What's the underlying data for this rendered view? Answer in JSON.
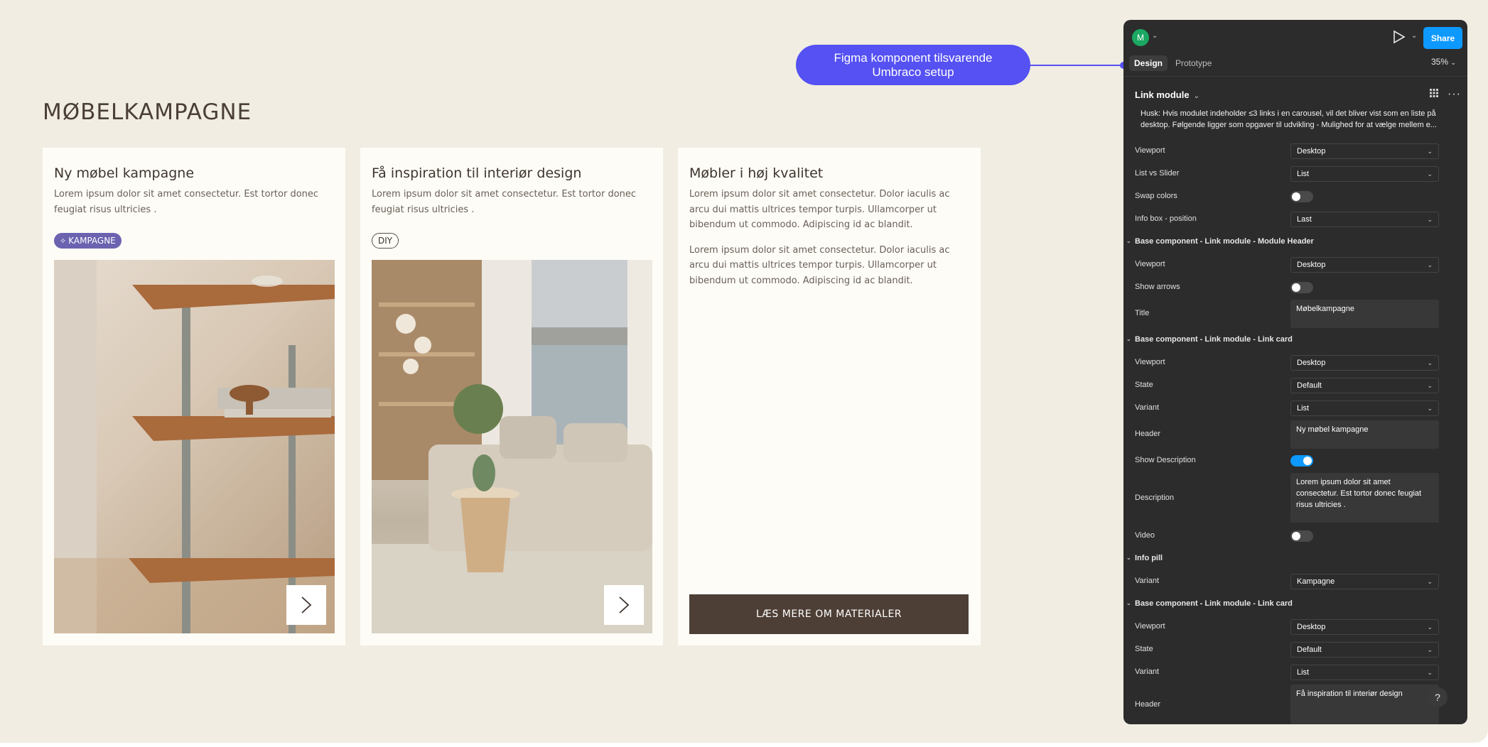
{
  "canvas": {
    "module_title": "MØBELKAMPAGNE",
    "cards": [
      {
        "header": "Ny møbel kampagne",
        "description": "Lorem ipsum dolor sit amet consectetur. Est tortor donec feugiat risus ultricies .",
        "pill": "KAMPAGNE",
        "image_alt": "Wooden shelf with books and mushroom lamp"
      },
      {
        "header": "Få inspiration til interiør design",
        "description": "Lorem ipsum dolor sit amet consectetur. Est tortor donec feugiat risus ultricies .",
        "pill": "DIY",
        "image_alt": "Living room with sofa, side table and lake view"
      },
      {
        "header": "Møbler i høj kvalitet",
        "paragraph_1": "Lorem ipsum dolor sit amet consectetur. Dolor iaculis ac arcu dui mattis ultrices tempor turpis. Ullamcorper ut bibendum ut commodo. Adipiscing id ac blandit.",
        "paragraph_2": "Lorem ipsum dolor sit amet consectetur. Dolor iaculis ac arcu dui mattis ultrices tempor turpis. Ullamcorper ut bibendum ut commodo. Adipiscing id ac blandit.",
        "cta": "LÆS MERE OM MATERIALER"
      }
    ]
  },
  "callout": {
    "line1": "Figma komponent tilsvarende",
    "line2": "Umbraco setup"
  },
  "panel": {
    "avatar_letter": "M",
    "share_label": "Share",
    "tabs": [
      "Design",
      "Prototype"
    ],
    "zoom": "35%",
    "component_name": "Link module",
    "note": "Husk: Hvis modulet indeholder ≤3 links i en carousel, vil det bliver vist som en liste på desktop. Følgende ligger som opgaver til udvikling - Mulighed for at vælge mellem e...",
    "props": [
      {
        "label": "Viewport",
        "value": "Desktop"
      },
      {
        "label": "List vs Slider",
        "value": "List"
      },
      {
        "label": "Swap colors"
      },
      {
        "label": "Info box - position",
        "value": "Last"
      }
    ],
    "section_header": "Base component - Link module - Module Header",
    "header_props": [
      {
        "label": "Viewport",
        "value": "Desktop"
      },
      {
        "label": "Show arrows"
      },
      {
        "label": "Title",
        "value": "Møbelkampagne"
      }
    ],
    "section_card1": "Base component - Link module - Link card",
    "card1_props": [
      {
        "label": "Viewport",
        "value": "Desktop"
      },
      {
        "label": "State",
        "value": "Default"
      },
      {
        "label": "Variant",
        "value": "List"
      },
      {
        "label": "Header",
        "value": "Ny møbel kampagne"
      },
      {
        "label": "Show Description"
      },
      {
        "label": "Description",
        "value": "Lorem ipsum dolor sit amet consectetur. Est tortor donec feugiat risus ultricies ."
      },
      {
        "label": "Video"
      }
    ],
    "section_pill": "Info pill",
    "pill_props": [
      {
        "label": "Variant",
        "value": "Kampagne"
      }
    ],
    "section_card2": "Base component - Link module - Link card",
    "card2_props": [
      {
        "label": "Viewport",
        "value": "Desktop"
      },
      {
        "label": "State",
        "value": "Default"
      },
      {
        "label": "Variant",
        "value": "List"
      },
      {
        "label": "Header",
        "value": "Få inspiration til interiør design"
      }
    ],
    "help_label": "?",
    "colors": {
      "accent": "#0d99ff",
      "callout": "#5551f2",
      "pill": "#6b63b0",
      "cta": "#4e3f36"
    }
  }
}
